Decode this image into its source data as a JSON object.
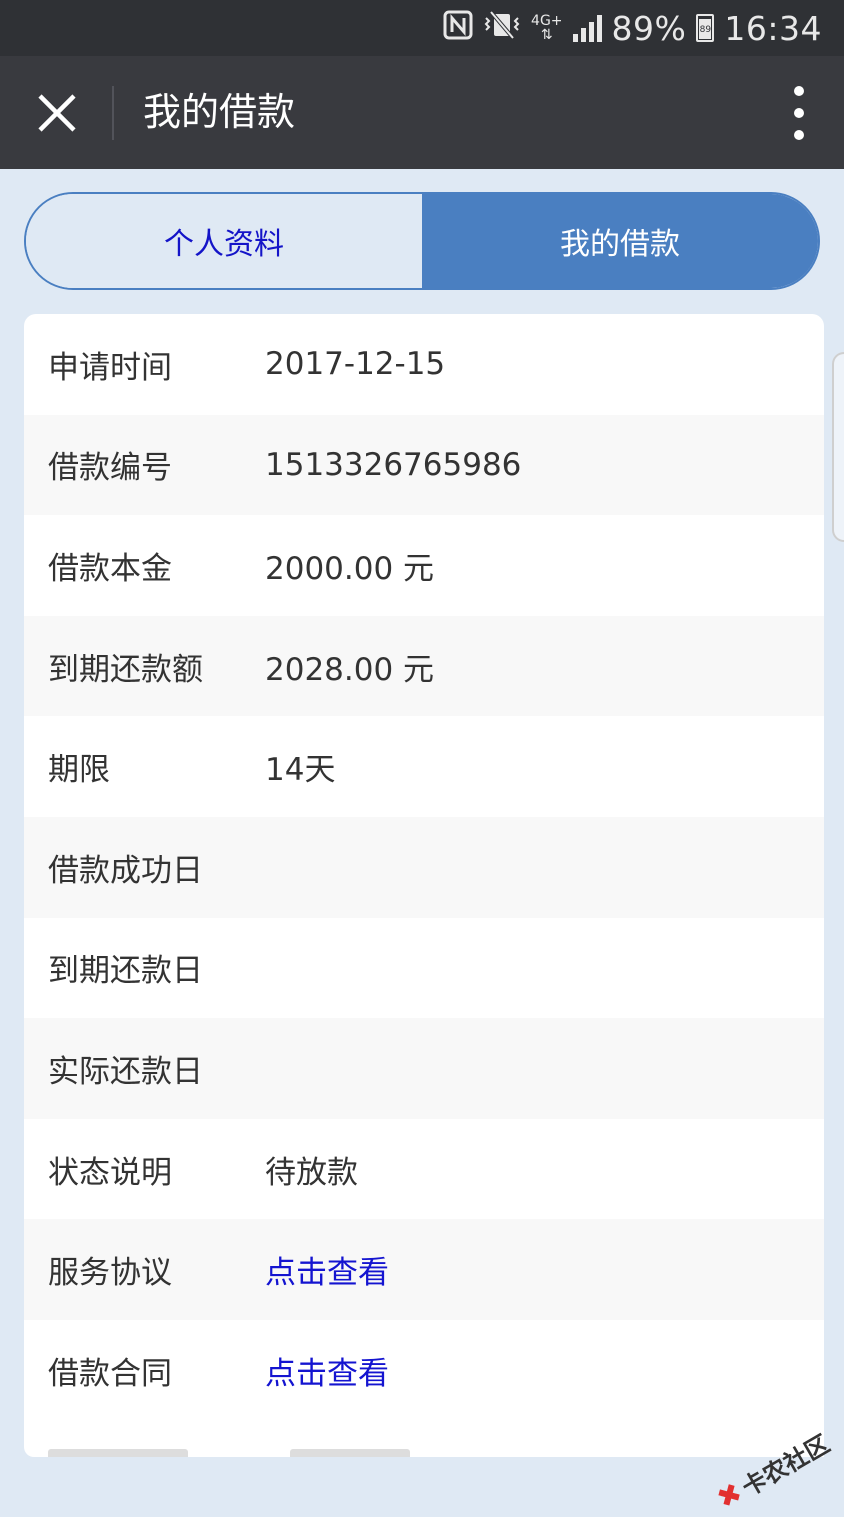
{
  "status_bar": {
    "battery_percent": "89%",
    "battery_level": "89",
    "network": "4G+",
    "time": "16:34"
  },
  "header": {
    "title": "我的借款"
  },
  "tabs": [
    {
      "label": "个人资料",
      "active": false
    },
    {
      "label": "我的借款",
      "active": true
    }
  ],
  "loan_details": [
    {
      "label": "申请时间",
      "value": "2017-12-15"
    },
    {
      "label": "借款编号",
      "value": "1513326765986"
    },
    {
      "label": "借款本金",
      "value": "2000.00 元"
    },
    {
      "label": "到期还款额",
      "value": "2028.00 元"
    },
    {
      "label": "期限",
      "value": "14天"
    },
    {
      "label": "借款成功日",
      "value": ""
    },
    {
      "label": "到期还款日",
      "value": ""
    },
    {
      "label": "实际还款日",
      "value": ""
    },
    {
      "label": "状态说明",
      "value": "待放款"
    },
    {
      "label": "服务协议",
      "value": "点击查看"
    },
    {
      "label": "借款合同",
      "value": "点击查看"
    }
  ],
  "watermark": "卡农社区",
  "colors": {
    "status_bar": "#2f3135",
    "title_bar": "#393a3f",
    "page_bg": "#dfe9f4",
    "accent": "#4a7fc1",
    "link": "#1414d0"
  }
}
